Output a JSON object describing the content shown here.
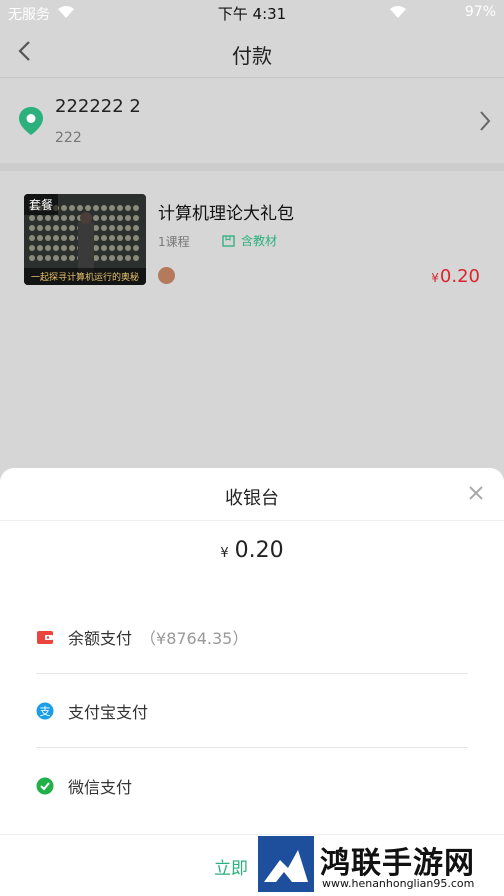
{
  "status_bar": {
    "carrier": "无服务",
    "time": "下午 4:31",
    "battery": "97%"
  },
  "header": {
    "title": "付款"
  },
  "address": {
    "name": "222222  2",
    "detail": "222"
  },
  "product": {
    "title": "计算机理论大礼包",
    "course_count": "1课程",
    "materials": "含教材",
    "price": "0.20",
    "currency": "¥",
    "thumb_tag": "套餐",
    "thumb_caption": "一起探寻计算机运行的奥秘"
  },
  "checkout": {
    "title": "收银台",
    "amount": "0.20",
    "currency": "¥",
    "methods": [
      {
        "label": "余额支付",
        "balance": "（¥8764.35）",
        "icon": "wallet-icon"
      },
      {
        "label": "支付宝支付",
        "icon": "alipay-icon"
      },
      {
        "label": "微信支付",
        "icon": "wechat-pay-icon"
      }
    ],
    "confirm_label": "立即"
  },
  "watermark": {
    "brand": "鸿联手游网",
    "url": "www.henanhonglian95.com"
  },
  "colors": {
    "accent_green": "#2bb07e",
    "price_red": "#d9262b",
    "overlay_gray": "#d6d6d6"
  }
}
